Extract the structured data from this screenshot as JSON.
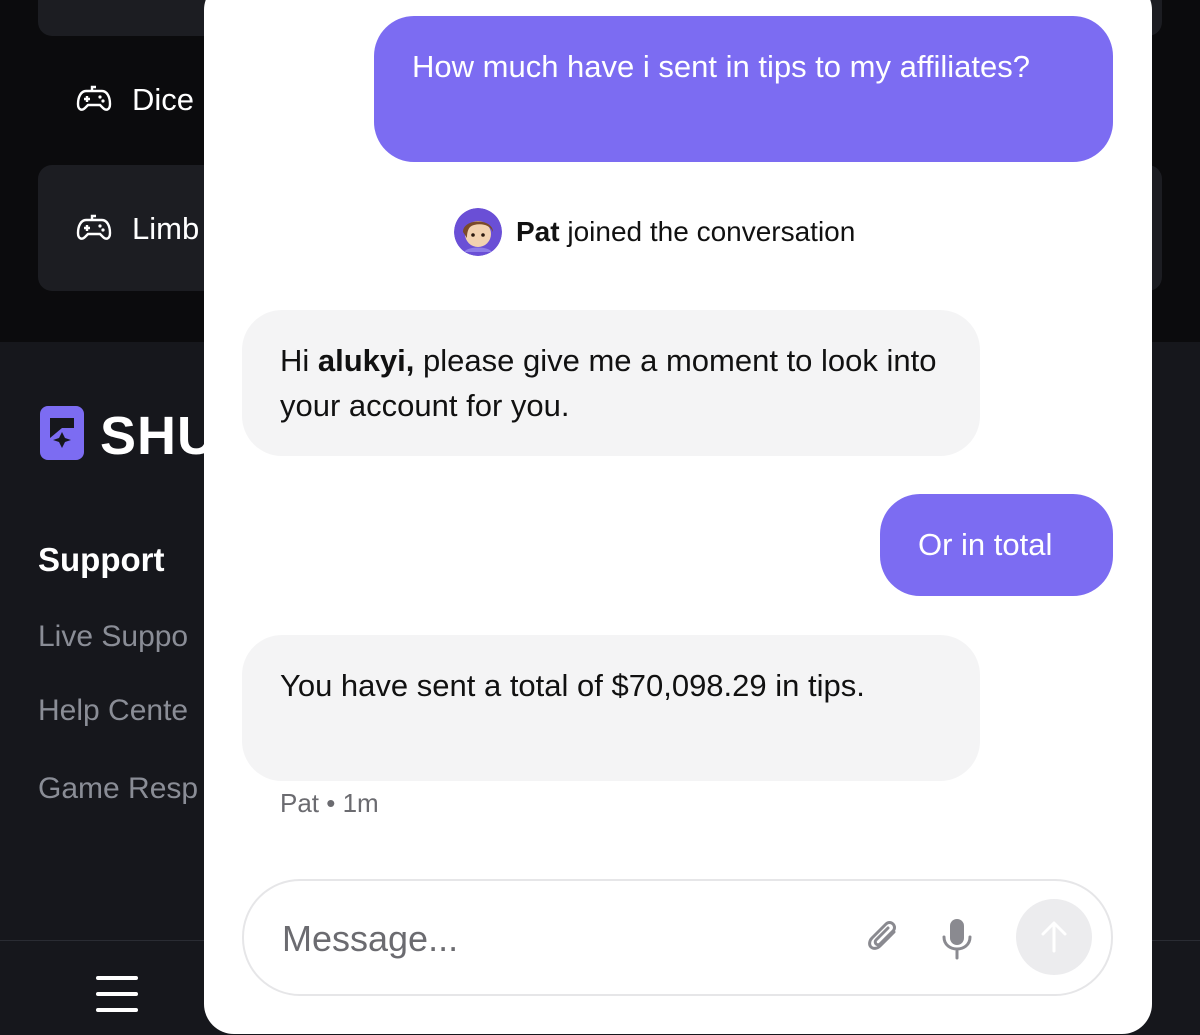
{
  "background": {
    "games": [
      {
        "label": "Dice"
      },
      {
        "label": "Limb"
      }
    ],
    "logo_text": "SHU",
    "support": {
      "title": "Support",
      "links": [
        "Live Suppo",
        "Help Cente",
        "Game Resp"
      ]
    }
  },
  "chat": {
    "messages": [
      {
        "role": "user",
        "text": "How much have i sent in tips to my affiliates?"
      },
      {
        "role": "agent",
        "pre": "Hi ",
        "bold": "alukyi,",
        "post": " please give me a moment to look into your account for you."
      },
      {
        "role": "user",
        "text": "Or in total"
      },
      {
        "role": "agent",
        "text": "You have sent a total of $70,098.29 in tips."
      }
    ],
    "join": {
      "name": "Pat",
      "text": " joined the conversation"
    },
    "meta": "Pat • 1m",
    "composer": {
      "placeholder": "Message..."
    }
  },
  "colors": {
    "user_bubble": "#7c6cf2",
    "agent_bubble": "#f4f4f5",
    "brand": "#7c6cf2"
  },
  "icons": [
    "gamepad-icon",
    "logo-icon",
    "paperclip-icon",
    "microphone-icon",
    "arrow-up-icon",
    "hamburger-icon",
    "avatar"
  ]
}
